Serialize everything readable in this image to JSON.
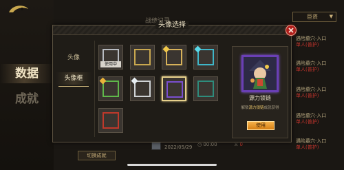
{
  "background": {
    "sidebar": {
      "tab_data": "数据",
      "tab_achievements": "成就"
    },
    "header_label": "战绩记录",
    "dropdown_label": "巨资",
    "rows": [
      {
        "line1": "遇险墓穴·入口",
        "line2": "单人(普护)"
      },
      {
        "line1": "遇险墓穴·入口",
        "line2": "单人(普护)"
      },
      {
        "line1": "遇险墓穴·入口",
        "line2": "单人(普护)"
      },
      {
        "line1": "遇险墓穴·入口",
        "line2": "单人(普护)"
      },
      {
        "line1": "遇险墓穴·入口",
        "line2": "单人(普护)"
      }
    ],
    "bottom_record": {
      "date": "2022/05/29",
      "time": "00:00",
      "kills": "0"
    },
    "switch_button": "切换成就"
  },
  "dialog": {
    "title": "头像选择",
    "tabs": [
      {
        "label": "头像",
        "active": false
      },
      {
        "label": "头像框",
        "active": true
      }
    ],
    "frames": [
      {
        "name": "default-frame",
        "color": "#b8bcc2",
        "in_use_label": "使用中",
        "selected": false
      },
      {
        "name": "gold-frame",
        "color": "#c9a84f",
        "selected": false
      },
      {
        "name": "gold-gem-frame",
        "color": "#d7b25a",
        "gem": "#f0c84a",
        "selected": false
      },
      {
        "name": "cyan-frame",
        "color": "#3fb7c9",
        "gem": "#59d8e8",
        "selected": false
      },
      {
        "name": "green-frame",
        "color": "#5fb84a",
        "gem": "#e9b33a",
        "selected": false
      },
      {
        "name": "silver-frame",
        "color": "#cfd3d6",
        "gem": "#e7eef2",
        "selected": false
      },
      {
        "name": "purple-frame",
        "color": "#7a4fd0",
        "selected": true
      },
      {
        "name": "teal-frame",
        "color": "#2e8c7c",
        "selected": false
      },
      {
        "name": "red-frame",
        "color": "#c0392b",
        "selected": false
      }
    ],
    "detail": {
      "name": "源力锁链",
      "description_prefix": "解锁",
      "description_highlight": "源力锁链",
      "description_suffix": "成就获得",
      "use_button": "使用",
      "accent": "#7a4fd0"
    }
  }
}
